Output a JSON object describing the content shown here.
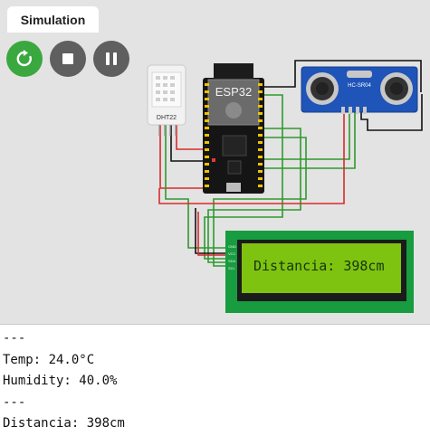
{
  "simulation": {
    "tab_label": "Simulation",
    "controls": {
      "restart_icon": "restart-icon",
      "stop_icon": "stop-icon",
      "pause_icon": "pause-icon"
    }
  },
  "circuit": {
    "esp32_label": "ESP32",
    "dht22_label": "DHT22",
    "ultrasonic_label": "HC-SR04",
    "lcd_pins": [
      "GND",
      "VCC",
      "SDA",
      "SCL"
    ],
    "lcd_text": "Distancia: 398cm"
  },
  "colors": {
    "lcd_screen": "#7ec310",
    "lcd_board": "#179c3f",
    "wire_red": "#d92a2a",
    "wire_green": "#2e9a2e",
    "wire_black": "#111111",
    "run_button": "#3aa83f"
  },
  "console": {
    "lines": [
      "---",
      "Temp: 24.0°C",
      "Humidity: 40.0%",
      "---",
      "Distancia: 398cm"
    ]
  }
}
